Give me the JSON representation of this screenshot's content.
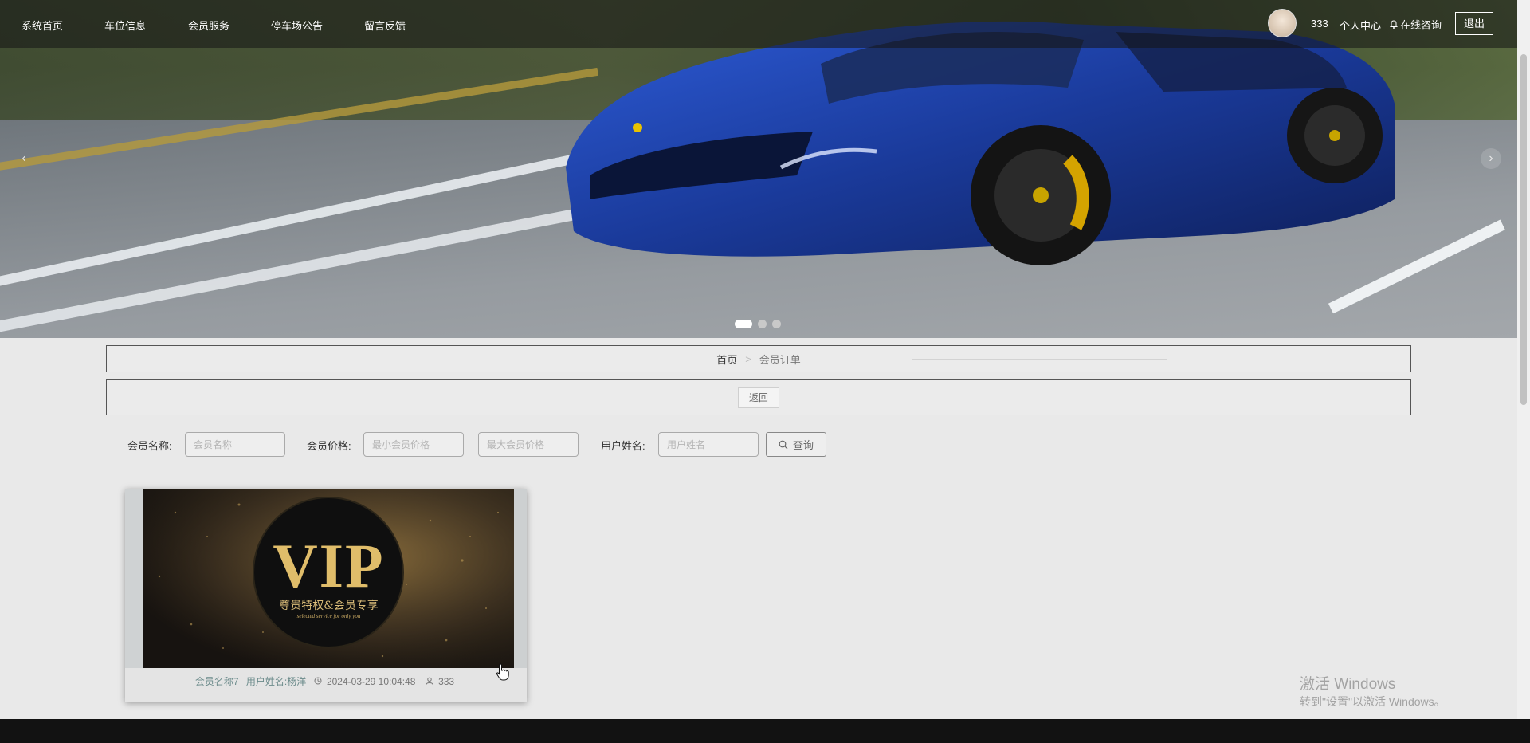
{
  "nav": {
    "items": [
      "系统首页",
      "车位信息",
      "会员服务",
      "停车场公告",
      "留言反馈"
    ],
    "username": "333",
    "user_center": "个人中心",
    "consult": "在线咨询",
    "logout": "退出"
  },
  "banner": {
    "prev": "‹",
    "next": "›",
    "slide_count": 3,
    "active_slide": 1
  },
  "breadcrumb": {
    "home": "首页",
    "separator": ">",
    "current": "会员订单"
  },
  "back_button": "返回",
  "search": {
    "member_name_label": "会员名称:",
    "member_name_placeholder": "会员名称",
    "price_label": "会员价格:",
    "min_price_placeholder": "最小会员价格",
    "max_price_placeholder": "最大会员价格",
    "user_name_label": "用户姓名:",
    "user_name_placeholder": "用户姓名",
    "query_button": "查询"
  },
  "orders": [
    {
      "image_badge": "VIP",
      "image_caption": "尊贵特权&会员专享",
      "image_subcaption": "selected service for only you",
      "member_name": "会员名称7",
      "user_name": "用户姓名:杨洋",
      "time": "2024-03-29 10:04:48",
      "account": "333"
    }
  ],
  "watermark": {
    "line1": "激活 Windows",
    "line2": "转到\"设置\"以激活 Windows。"
  },
  "colors": {
    "navbar": "#141414",
    "card_meta": "#6a8a8a",
    "footer": "#121212"
  }
}
